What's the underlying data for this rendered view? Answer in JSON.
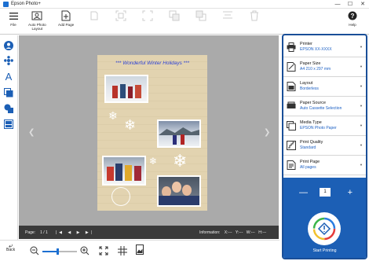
{
  "window": {
    "title": "Epson Photo+"
  },
  "toolbar": {
    "file_label": "File",
    "auto_photo_label_line1": "Auto Photo",
    "auto_photo_label_line2": "Layout",
    "add_page_label": "Add Page",
    "help_label": "Help"
  },
  "canvas": {
    "page_title": "*** Wonderful Winter Holidays ***"
  },
  "status": {
    "pages_label": "Page:",
    "pages_value": "1 / 1",
    "info_label": "Information:",
    "info_x": "X:",
    "info_y": "Y:",
    "info_w": "W:",
    "info_h": "H:",
    "info_dash": "---"
  },
  "bottom": {
    "back_label": "Back"
  },
  "zoom": {
    "level": 0.45
  },
  "settings": [
    {
      "label": "Printer",
      "value": "EPSON XX-XXXX",
      "icon": "printer-icon"
    },
    {
      "label": "Paper Size",
      "value": "A4 210 x 297 mm",
      "icon": "paper-size-icon"
    },
    {
      "label": "Layout",
      "value": "Borderless",
      "icon": "layout-icon"
    },
    {
      "label": "Paper Source",
      "value": "Auto Cassette Selection",
      "icon": "paper-source-icon"
    },
    {
      "label": "Media Type",
      "value": "EPSON Photo Paper",
      "icon": "media-type-icon"
    },
    {
      "label": "Print Quality",
      "value": "Standard",
      "icon": "print-quality-icon"
    },
    {
      "label": "Print Page",
      "value": "All pages",
      "icon": "print-page-icon"
    }
  ],
  "print": {
    "copies": "1",
    "start_label": "Start Printing"
  },
  "colors": {
    "accent": "#1c5fb5",
    "panel_border": "#1a4f98",
    "title_text": "#2a3fd6",
    "value_text": "#1a5fc4"
  }
}
